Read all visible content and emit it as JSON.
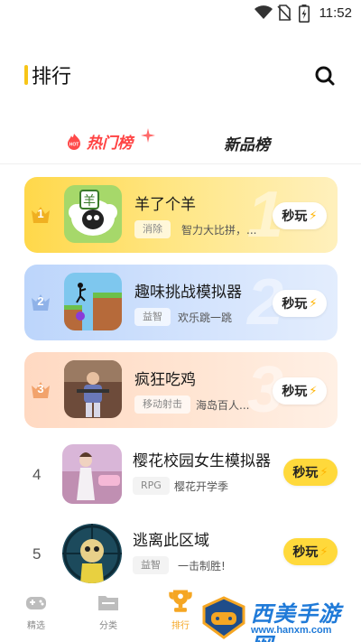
{
  "status_bar": {
    "time": "11:52"
  },
  "header": {
    "title": "排行"
  },
  "tabs": [
    {
      "label": "热门榜",
      "badge": "HOT",
      "active": true
    },
    {
      "label": "新品榜",
      "active": false
    }
  ],
  "ranking": [
    {
      "rank": "1",
      "name": "羊了个羊",
      "tag": "消除",
      "desc": "智力大比拼，...",
      "play": "秒玩",
      "big_num": "1"
    },
    {
      "rank": "2",
      "name": "趣味挑战模拟器",
      "tag": "益智",
      "desc": "欢乐跳一跳",
      "play": "秒玩",
      "big_num": "2"
    },
    {
      "rank": "3",
      "name": "疯狂吃鸡",
      "tag": "移动射击",
      "desc": "海岛百人...",
      "play": "秒玩",
      "big_num": "3"
    },
    {
      "rank": "4",
      "name": "樱花校园女生模拟器",
      "tag": "RPG",
      "desc": "樱花开学季",
      "play": "秒玩"
    },
    {
      "rank": "5",
      "name": "逃离此区域",
      "tag": "益智",
      "desc": "一击制胜!",
      "play": "秒玩"
    }
  ],
  "bottom_nav": [
    {
      "label": "精选",
      "icon": "gamepad-icon",
      "active": false
    },
    {
      "label": "分类",
      "icon": "folder-icon",
      "active": false
    },
    {
      "label": "排行",
      "icon": "trophy-icon",
      "active": true
    }
  ],
  "watermark": {
    "title": "西美手游网",
    "url": "www.hanxm.com"
  },
  "colors": {
    "accent": "#f7c518",
    "hot": "#ff4242",
    "play_button": "#ffd93b",
    "rank1_card": "#ffd84a",
    "rank2_card": "#bcd5fb",
    "rank3_card": "#ffd9c2",
    "watermark": "#1f7ad8"
  }
}
